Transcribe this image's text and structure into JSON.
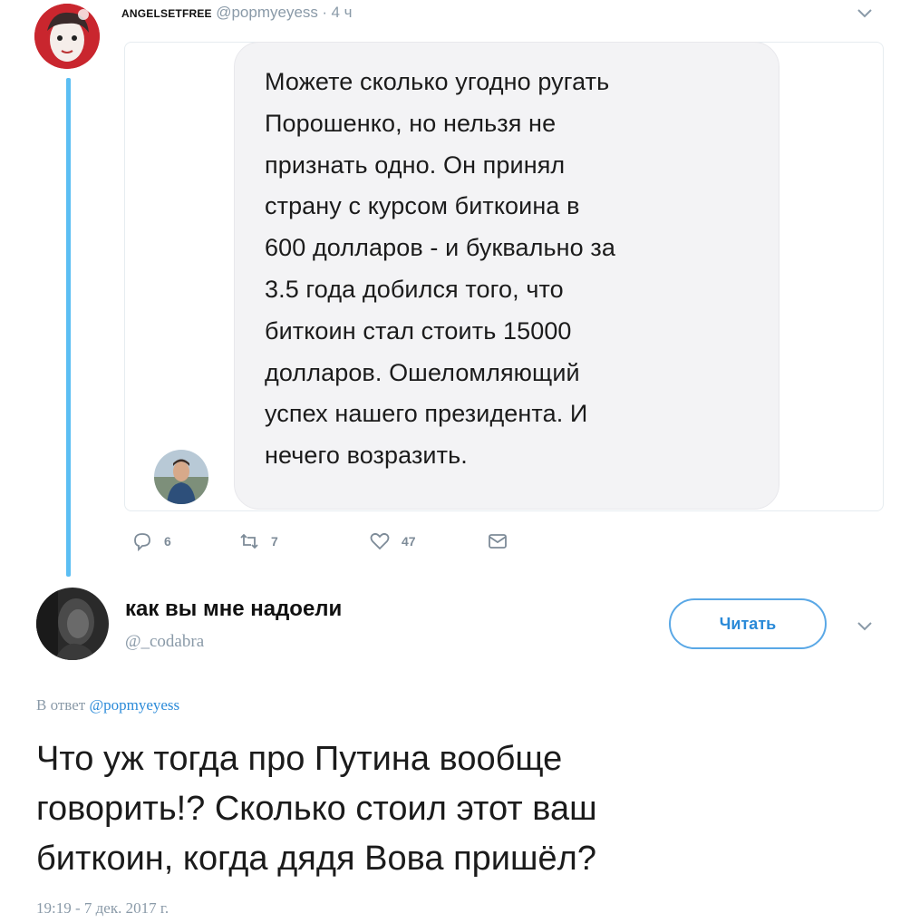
{
  "tweet1": {
    "name": "ANGELSETFREE",
    "handle": "@popmyeyess",
    "separator": "·",
    "time": "4 ч",
    "image_text": "Можете сколько угодно ругать\nПорошенко, но нельзя не\nпризнать одно.   Он принял\nстрану с курсом биткоина в\n600 долларов - и буквально за\n3.5 года добился того, что\nбиткоин стал стоить 15000\nдолларов.   Ошеломляющий\nуспех нашего президента.   И\nнечего возразить.",
    "actions": {
      "replies": "6",
      "retweets": "7",
      "likes": "47"
    }
  },
  "tweet2": {
    "name": "как вы мне надоели",
    "handle": "@_codabra",
    "follow_label": "Читать",
    "reply_prefix": "В ответ",
    "reply_handle": "@popmyeyess",
    "text": "Что уж тогда про Путина вообще\nговорить!? Сколько стоил этот ваш\nбиткоин, когда дядя Вова пришёл?",
    "timestamp": "19:19 - 7 дек. 2017 г."
  },
  "colors": {
    "accent": "#2a8ad8",
    "thread_line": "#5bbef3",
    "muted_text": "#8a9aa8",
    "bubble_bg": "#f3f3f5"
  },
  "icons": [
    "reply-icon",
    "retweet-icon",
    "like-icon",
    "message-icon",
    "chevron-down-icon"
  ]
}
